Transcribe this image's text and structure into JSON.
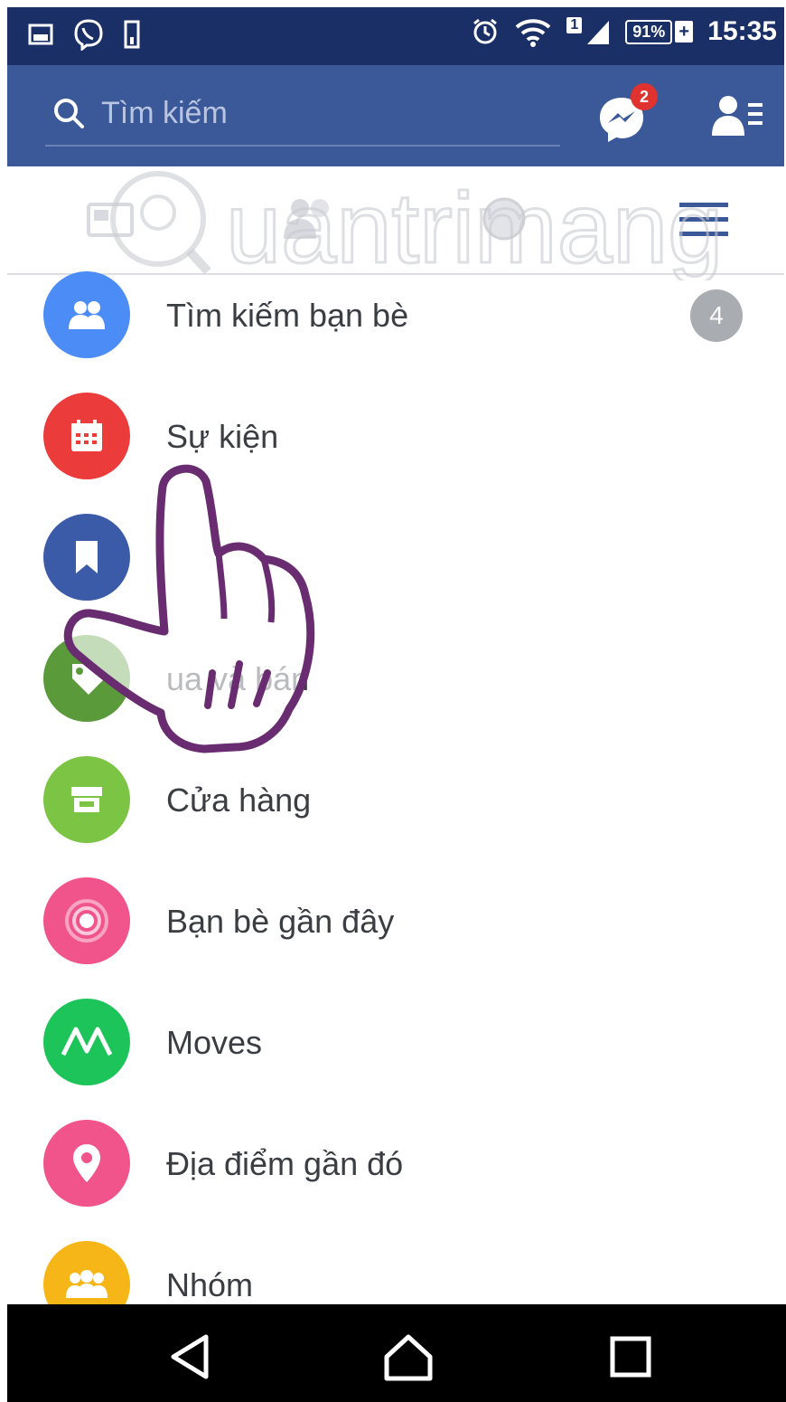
{
  "status_bar": {
    "battery_percent": "91%",
    "battery_charging_symbol": "+",
    "sim_indicator": "1",
    "time": "15:35",
    "icons": [
      "image-icon",
      "viber-icon",
      "phone-icon",
      "alarm-icon",
      "wifi-icon",
      "signal-icon",
      "battery-icon"
    ]
  },
  "search": {
    "placeholder": "Tìm kiếm"
  },
  "header": {
    "messenger_badge": "2"
  },
  "tabs": {
    "icons": [
      "news-feed-icon",
      "friend-requests-icon",
      "notifications-icon",
      "globe-icon",
      "menu-icon"
    ]
  },
  "menu": {
    "items": [
      {
        "label": "Tìm kiếm bạn bè",
        "icon": "friends-icon",
        "color": "#4b8cf7",
        "badge": "4"
      },
      {
        "label": "Sự kiện",
        "icon": "calendar-icon",
        "color": "#ec3b3b"
      },
      {
        "label": "",
        "icon": "bookmark-icon",
        "color": "#3b5ba8"
      },
      {
        "label": "ua và bán",
        "icon": "tag-icon",
        "color": "#5b9a3a"
      },
      {
        "label": "Cửa hàng",
        "icon": "shop-icon",
        "color": "#7cc444"
      },
      {
        "label": "Bạn bè gần đây",
        "icon": "nearby-icon",
        "color": "#f0548a"
      },
      {
        "label": "Moves",
        "icon": "moves-icon",
        "color": "#1cc45a"
      },
      {
        "label": "Địa điểm gần đó",
        "icon": "location-pin-icon",
        "color": "#f0548a"
      },
      {
        "label": "Nhóm",
        "icon": "groups-icon",
        "color": "#f7b617"
      }
    ]
  },
  "colors": {
    "header_blue": "#3b5998",
    "status_bar": "#1a2f66",
    "badge_red": "#e0322f",
    "badge_gray": "#a9acb1"
  }
}
